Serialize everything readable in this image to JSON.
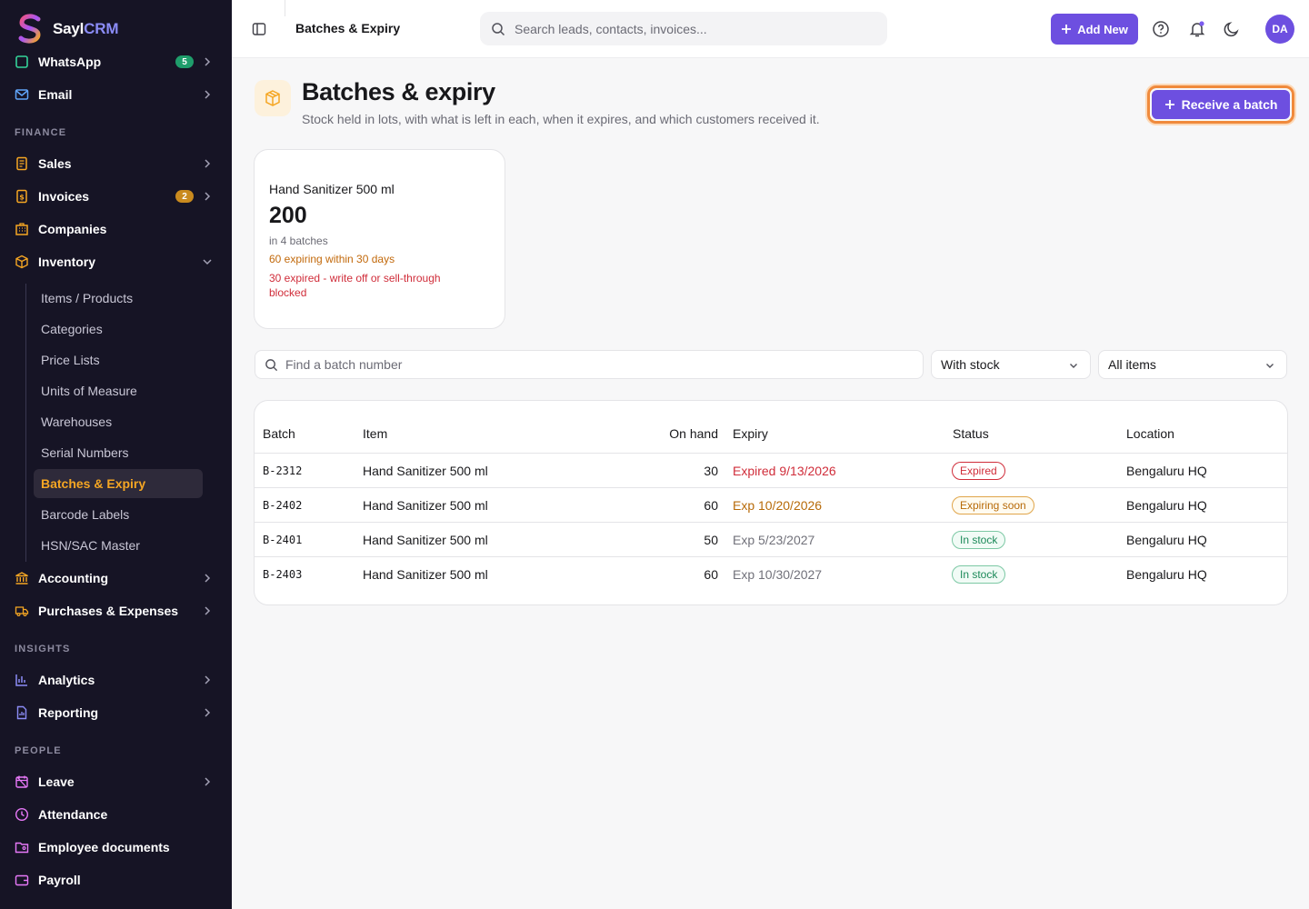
{
  "brand": {
    "name_part1": "Sayl",
    "name_part2": "CRM"
  },
  "sidebar": {
    "top_items": [
      {
        "label": "WhatsApp",
        "badge": "5"
      },
      {
        "label": "Email"
      }
    ],
    "finance_label": "FINANCE",
    "finance_items": [
      {
        "label": "Sales"
      },
      {
        "label": "Invoices",
        "badge": "2"
      },
      {
        "label": "Companies"
      },
      {
        "label": "Inventory"
      }
    ],
    "inventory_subitems": [
      "Items / Products",
      "Categories",
      "Price Lists",
      "Units of Measure",
      "Warehouses",
      "Serial Numbers",
      "Batches & Expiry",
      "Barcode Labels",
      "HSN/SAC Master"
    ],
    "finance_items2": [
      {
        "label": "Accounting"
      },
      {
        "label": "Purchases & Expenses"
      }
    ],
    "insights_label": "INSIGHTS",
    "insights_items": [
      {
        "label": "Analytics"
      },
      {
        "label": "Reporting"
      }
    ],
    "people_label": "PEOPLE",
    "people_items": [
      {
        "label": "Leave"
      },
      {
        "label": "Attendance"
      },
      {
        "label": "Employee documents"
      },
      {
        "label": "Payroll"
      }
    ]
  },
  "topbar": {
    "crumb": "Batches & Expiry",
    "search_placeholder": "Search leads, contacts, invoices...",
    "add_new": "Add New",
    "avatar": "DA"
  },
  "header": {
    "title": "Batches & expiry",
    "subtitle": "Stock held in lots, with what is left in each, when it expires, and which customers received it.",
    "receive_button": "Receive a batch"
  },
  "summary_card": {
    "item": "Hand Sanitizer 500 ml",
    "total": "200",
    "batches": "in 4 batches",
    "expiring": "60 expiring within 30 days",
    "expired": "30 expired - write off or sell-through blocked"
  },
  "filters": {
    "find_placeholder": "Find a batch number",
    "stock_filter": "With stock",
    "item_filter": "All items"
  },
  "table": {
    "headers": [
      "Batch",
      "Item",
      "On hand",
      "Expiry",
      "Status",
      "Location"
    ],
    "rows": [
      {
        "batch": "B-2312",
        "item": "Hand Sanitizer 500 ml",
        "on_hand": "30",
        "expiry": "Expired 9/13/2026",
        "status": "Expired",
        "location": "Bengaluru HQ"
      },
      {
        "batch": "B-2402",
        "item": "Hand Sanitizer 500 ml",
        "on_hand": "60",
        "expiry": "Exp 10/20/2026",
        "status": "Expiring soon",
        "location": "Bengaluru HQ"
      },
      {
        "batch": "B-2401",
        "item": "Hand Sanitizer 500 ml",
        "on_hand": "50",
        "expiry": "Exp 5/23/2027",
        "status": "In stock",
        "location": "Bengaluru HQ"
      },
      {
        "batch": "B-2403",
        "item": "Hand Sanitizer 500 ml",
        "on_hand": "60",
        "expiry": "Exp 10/30/2027",
        "status": "In stock",
        "location": "Bengaluru HQ"
      }
    ]
  },
  "colors": {
    "accent": "#6d4fe0",
    "sidebar_bg": "#161425",
    "active_nav": "#f5a623",
    "expired": "#d02d3a",
    "expiring": "#c2690b",
    "in_stock": "#1d8a5a"
  }
}
